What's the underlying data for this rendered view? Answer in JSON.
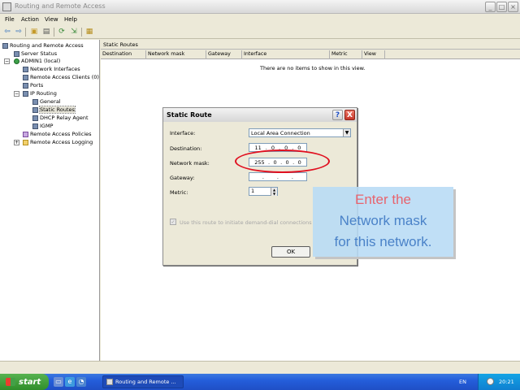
{
  "window": {
    "title": "Routing and Remote Access"
  },
  "menu": [
    "File",
    "Action",
    "View",
    "Help"
  ],
  "tree": {
    "root": "Routing and Remote Access",
    "items": [
      "Server Status",
      "ADMIN1 (local)",
      "Network Interfaces",
      "Remote Access Clients (0)",
      "Ports",
      "IP Routing",
      "General",
      "Static Routes",
      "DHCP Relay Agent",
      "IGMP",
      "Remote Access Policies",
      "Remote Access Logging"
    ]
  },
  "list": {
    "pane_title": "Static Routes",
    "columns": [
      "Destination",
      "Network mask",
      "Gateway",
      "Interface",
      "Metric",
      "View"
    ],
    "empty_message": "There are no items to show in this view."
  },
  "dialog": {
    "title": "Static Route",
    "interface_label": "Interface:",
    "interface_value": "Local Area Connection",
    "destination_label": "Destination:",
    "destination": [
      "11",
      "0",
      "0",
      "0"
    ],
    "mask_label": "Network mask:",
    "mask": [
      "255",
      "0",
      "0",
      "0"
    ],
    "gateway_label": "Gateway:",
    "metric_label": "Metric:",
    "metric_value": "1",
    "checkbox_label": "Use this route to initiate demand-dial connections",
    "ok_label": "OK",
    "help_label": "?",
    "close_label": "X"
  },
  "callout": {
    "lines": [
      "Enter the",
      "Network mask",
      "for this network."
    ],
    "colors": {
      "pink": "#e8646e",
      "blue": "#4a82c8",
      "box": "#b9dcf5"
    }
  },
  "taskbar": {
    "start_label": "start",
    "task_item": "Routing and Remote ...",
    "lang": "EN",
    "clock": "20:21"
  }
}
